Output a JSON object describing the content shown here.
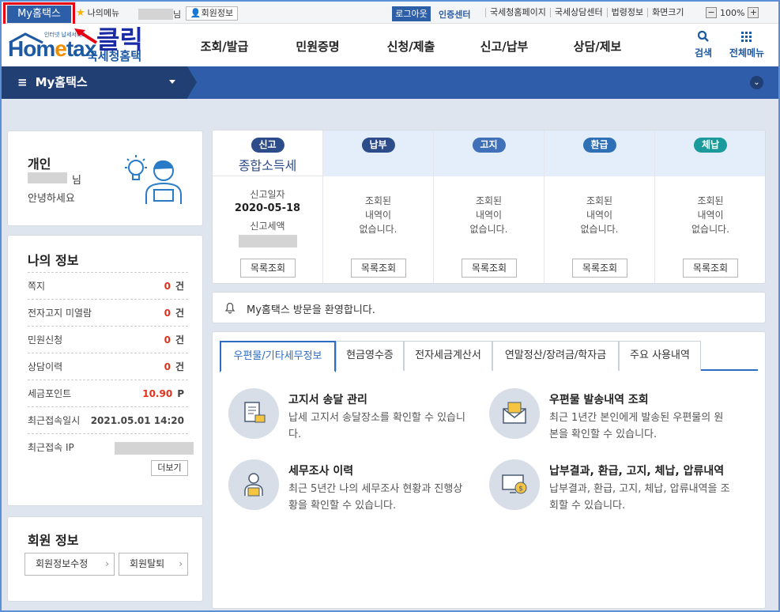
{
  "topbar": {
    "myhome_tab": "My홈택스",
    "my_menu": "나의메뉴",
    "user_suffix": "님",
    "member_info": "회원정보",
    "logout": "로그아웃",
    "cert_center": "인증센터",
    "links": [
      "국세청홈페이지",
      "국세상담센터",
      "법령정보",
      "화면크기"
    ],
    "zoom_value": "100%",
    "zoom_minus": "−",
    "zoom_plus": "+"
  },
  "annotation": {
    "click_label": "클릭",
    "highlight_color": "#e60012"
  },
  "header": {
    "logo_small": "인터넷 납세서비스",
    "logo_main_a": "Hom",
    "logo_main_e": "e",
    "logo_main_b": "tax",
    "logo_sub": "국세청홈택스",
    "nav": [
      "조회/발급",
      "민원증명",
      "신청/제출",
      "신고/납부",
      "상담/제보"
    ],
    "search_label": "검색",
    "allmenu_label": "전체메뉴"
  },
  "navband": {
    "title": "My홈택스",
    "menu_icon": "hamburger-icon"
  },
  "profile": {
    "type": "개인",
    "name_suffix": "님",
    "greeting": "안녕하세요"
  },
  "myinfo": {
    "title": "나의 정보",
    "rows": [
      {
        "label": "쪽지",
        "value": "0",
        "unit": "건"
      },
      {
        "label": "전자고지 미열람",
        "value": "0",
        "unit": "건"
      },
      {
        "label": "민원신청",
        "value": "0",
        "unit": "건"
      },
      {
        "label": "상담이력",
        "value": "0",
        "unit": "건"
      },
      {
        "label": "세금포인트",
        "value": "10.90",
        "unit": "P"
      },
      {
        "label": "최근접속일시",
        "value": "2021.05.01 14:20",
        "unit": ""
      },
      {
        "label": "최근접속 IP",
        "value": "",
        "unit": ""
      }
    ],
    "more_button": "더보기"
  },
  "member": {
    "title": "회원 정보",
    "edit_button": "회원정보수정",
    "withdraw_button": "회원탈퇴"
  },
  "tax_status": {
    "columns": [
      {
        "badge": "신고",
        "sub": "종합소득세",
        "lines": [
          "신고일자"
        ],
        "date": "2020-05-18",
        "extra": "신고세액",
        "button": "목록조회"
      },
      {
        "badge": "납부",
        "lines": [
          "조회된",
          "내역이",
          "없습니다."
        ],
        "button": "목록조회"
      },
      {
        "badge": "고지",
        "lines": [
          "조회된",
          "내역이",
          "없습니다."
        ],
        "button": "목록조회"
      },
      {
        "badge": "환급",
        "lines": [
          "조회된",
          "내역이",
          "없습니다."
        ],
        "button": "목록조회"
      },
      {
        "badge": "체납",
        "lines": [
          "조회된",
          "내역이",
          "없습니다."
        ],
        "button": "목록조회"
      }
    ]
  },
  "notice": {
    "text": "My홈택스 방문을 환영합니다."
  },
  "services": {
    "tabs": [
      "우편물/기타세무정보",
      "현금영수증",
      "전자세금계산서",
      "연말정산/장려금/학자금",
      "주요 사용내역"
    ],
    "items": [
      {
        "title": "고지서 송달 관리",
        "desc": "납세 고지서 송달장소를 확인할 수 있습니다.",
        "icon": "document-icon"
      },
      {
        "title": "우편물 발송내역 조회",
        "desc": "최근 1년간 본인에게 발송된 우편물의 원본을 확인할 수 있습니다.",
        "icon": "mail-icon"
      },
      {
        "title": "세무조사 이력",
        "desc": "최근 5년간 나의 세무조사 현황과 진행상황을 확인할 수 있습니다.",
        "icon": "person-laptop-icon"
      },
      {
        "title": "납부결과, 환급, 고지, 체납, 압류내역",
        "desc": "납부결과, 환급, 고지, 체납, 압류내역을 조회할 수 있습니다.",
        "icon": "monitor-money-icon"
      }
    ]
  }
}
